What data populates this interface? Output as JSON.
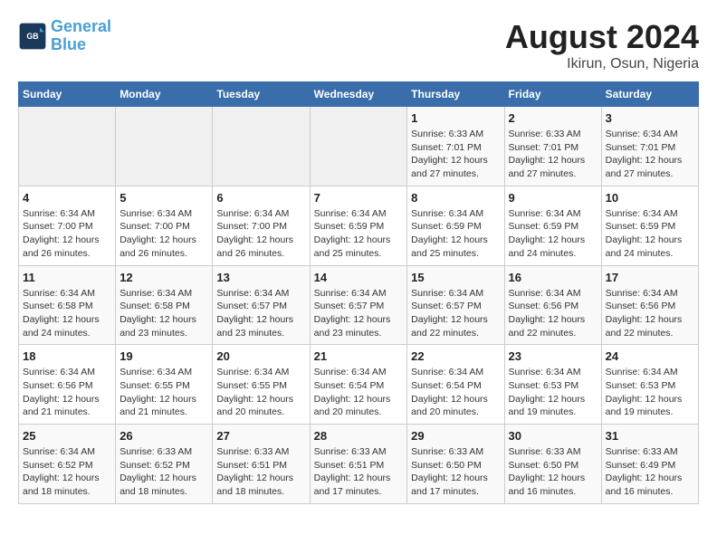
{
  "header": {
    "logo_text_general": "General",
    "logo_text_blue": "Blue",
    "title": "August 2024",
    "subtitle": "Ikirun, Osun, Nigeria"
  },
  "weekdays": [
    "Sunday",
    "Monday",
    "Tuesday",
    "Wednesday",
    "Thursday",
    "Friday",
    "Saturday"
  ],
  "weeks": [
    [
      {
        "day": "",
        "info": ""
      },
      {
        "day": "",
        "info": ""
      },
      {
        "day": "",
        "info": ""
      },
      {
        "day": "",
        "info": ""
      },
      {
        "day": "1",
        "info": "Sunrise: 6:33 AM\nSunset: 7:01 PM\nDaylight: 12 hours\nand 27 minutes."
      },
      {
        "day": "2",
        "info": "Sunrise: 6:33 AM\nSunset: 7:01 PM\nDaylight: 12 hours\nand 27 minutes."
      },
      {
        "day": "3",
        "info": "Sunrise: 6:34 AM\nSunset: 7:01 PM\nDaylight: 12 hours\nand 27 minutes."
      }
    ],
    [
      {
        "day": "4",
        "info": "Sunrise: 6:34 AM\nSunset: 7:00 PM\nDaylight: 12 hours\nand 26 minutes."
      },
      {
        "day": "5",
        "info": "Sunrise: 6:34 AM\nSunset: 7:00 PM\nDaylight: 12 hours\nand 26 minutes."
      },
      {
        "day": "6",
        "info": "Sunrise: 6:34 AM\nSunset: 7:00 PM\nDaylight: 12 hours\nand 26 minutes."
      },
      {
        "day": "7",
        "info": "Sunrise: 6:34 AM\nSunset: 6:59 PM\nDaylight: 12 hours\nand 25 minutes."
      },
      {
        "day": "8",
        "info": "Sunrise: 6:34 AM\nSunset: 6:59 PM\nDaylight: 12 hours\nand 25 minutes."
      },
      {
        "day": "9",
        "info": "Sunrise: 6:34 AM\nSunset: 6:59 PM\nDaylight: 12 hours\nand 24 minutes."
      },
      {
        "day": "10",
        "info": "Sunrise: 6:34 AM\nSunset: 6:59 PM\nDaylight: 12 hours\nand 24 minutes."
      }
    ],
    [
      {
        "day": "11",
        "info": "Sunrise: 6:34 AM\nSunset: 6:58 PM\nDaylight: 12 hours\nand 24 minutes."
      },
      {
        "day": "12",
        "info": "Sunrise: 6:34 AM\nSunset: 6:58 PM\nDaylight: 12 hours\nand 23 minutes."
      },
      {
        "day": "13",
        "info": "Sunrise: 6:34 AM\nSunset: 6:57 PM\nDaylight: 12 hours\nand 23 minutes."
      },
      {
        "day": "14",
        "info": "Sunrise: 6:34 AM\nSunset: 6:57 PM\nDaylight: 12 hours\nand 23 minutes."
      },
      {
        "day": "15",
        "info": "Sunrise: 6:34 AM\nSunset: 6:57 PM\nDaylight: 12 hours\nand 22 minutes."
      },
      {
        "day": "16",
        "info": "Sunrise: 6:34 AM\nSunset: 6:56 PM\nDaylight: 12 hours\nand 22 minutes."
      },
      {
        "day": "17",
        "info": "Sunrise: 6:34 AM\nSunset: 6:56 PM\nDaylight: 12 hours\nand 22 minutes."
      }
    ],
    [
      {
        "day": "18",
        "info": "Sunrise: 6:34 AM\nSunset: 6:56 PM\nDaylight: 12 hours\nand 21 minutes."
      },
      {
        "day": "19",
        "info": "Sunrise: 6:34 AM\nSunset: 6:55 PM\nDaylight: 12 hours\nand 21 minutes."
      },
      {
        "day": "20",
        "info": "Sunrise: 6:34 AM\nSunset: 6:55 PM\nDaylight: 12 hours\nand 20 minutes."
      },
      {
        "day": "21",
        "info": "Sunrise: 6:34 AM\nSunset: 6:54 PM\nDaylight: 12 hours\nand 20 minutes."
      },
      {
        "day": "22",
        "info": "Sunrise: 6:34 AM\nSunset: 6:54 PM\nDaylight: 12 hours\nand 20 minutes."
      },
      {
        "day": "23",
        "info": "Sunrise: 6:34 AM\nSunset: 6:53 PM\nDaylight: 12 hours\nand 19 minutes."
      },
      {
        "day": "24",
        "info": "Sunrise: 6:34 AM\nSunset: 6:53 PM\nDaylight: 12 hours\nand 19 minutes."
      }
    ],
    [
      {
        "day": "25",
        "info": "Sunrise: 6:34 AM\nSunset: 6:52 PM\nDaylight: 12 hours\nand 18 minutes."
      },
      {
        "day": "26",
        "info": "Sunrise: 6:33 AM\nSunset: 6:52 PM\nDaylight: 12 hours\nand 18 minutes."
      },
      {
        "day": "27",
        "info": "Sunrise: 6:33 AM\nSunset: 6:51 PM\nDaylight: 12 hours\nand 18 minutes."
      },
      {
        "day": "28",
        "info": "Sunrise: 6:33 AM\nSunset: 6:51 PM\nDaylight: 12 hours\nand 17 minutes."
      },
      {
        "day": "29",
        "info": "Sunrise: 6:33 AM\nSunset: 6:50 PM\nDaylight: 12 hours\nand 17 minutes."
      },
      {
        "day": "30",
        "info": "Sunrise: 6:33 AM\nSunset: 6:50 PM\nDaylight: 12 hours\nand 16 minutes."
      },
      {
        "day": "31",
        "info": "Sunrise: 6:33 AM\nSunset: 6:49 PM\nDaylight: 12 hours\nand 16 minutes."
      }
    ]
  ]
}
